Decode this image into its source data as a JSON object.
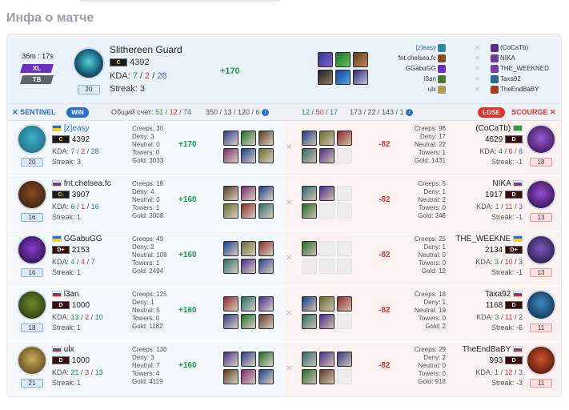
{
  "page_title": "Инфа о матче",
  "summary": {
    "duration": "36m : 17s",
    "badge_size": "XL",
    "badge_mode": "TB",
    "hero": "Slithereen Guard",
    "rank": "C",
    "rating": "4392",
    "kda_label": "KDA:",
    "kills": "7",
    "deaths": "2",
    "assists": "28",
    "streak": "Streak: 3",
    "level": "20",
    "gain": "+170",
    "sentinel_players": [
      "[z]easy",
      "fnt.chelsea.fc",
      "GGabuGG",
      "l3an",
      "ulx"
    ],
    "scourge_players": [
      "(CoCaTb)",
      "NIKA",
      "THE_WEEKNED",
      "Taxa92",
      "TheEndBaBY"
    ]
  },
  "scorebar": {
    "sentinel": "SENTINEL",
    "win": "WIN",
    "total_label": "Общий счет:",
    "s_k": "51",
    "s_d": "12",
    "s_a": "74",
    "s_extra": "350 / 13 / 120 / 6",
    "d_k": "12",
    "d_d": "50",
    "d_a": "17",
    "d_extra": "173 / 22 / 143 / 1",
    "lose": "LOSE",
    "scourge": "SCOURGE"
  },
  "rows": [
    {
      "rad": {
        "name": "[z]easy",
        "rank": "C",
        "rating": "4392",
        "kda_label": "KDA:",
        "k": "7",
        "d": "2",
        "a": "28",
        "streak": "Streak: 3",
        "level": "20",
        "creeps": "Creeps: 30",
        "deny": "Deny: 3",
        "neutral": "Neutral: 0",
        "towers": "Towers: 0",
        "gold": "Gold: 3033",
        "gain": "+170"
      },
      "dire": {
        "name": "(CoCaTb)",
        "rank": "D",
        "rating": "4629",
        "kda_label": "KDA:",
        "k": "4",
        "d": "6",
        "a": "6",
        "streak": "Streak: -1",
        "level": "18",
        "creeps": "Creeps: 96",
        "deny": "Deny: 17",
        "neutral": "Neutral: 22",
        "towers": "Towers: 1",
        "gold": "Gold: 1431",
        "gain": "-82"
      }
    },
    {
      "rad": {
        "name": "fnt.chelsea.fc",
        "rank": "C-",
        "rating": "3907",
        "kda_label": "KDA:",
        "k": "6",
        "d": "1",
        "a": "16",
        "streak": "Streak: 1",
        "level": "16",
        "creeps": "Creeps: 16",
        "deny": "Deny: 4",
        "neutral": "Neutral: 0",
        "towers": "Towers: 1",
        "gold": "Gold: 3008",
        "gain": "+160"
      },
      "dire": {
        "name": "NIKA",
        "rank": "D",
        "rating": "1917",
        "kda_label": "KDA:",
        "k": "1",
        "d": "11",
        "a": "3",
        "streak": "Streak: -1",
        "level": "13",
        "creeps": "Creeps: 5",
        "deny": "Deny: 1",
        "neutral": "Neutral: 2",
        "towers": "Towers: 0",
        "gold": "Gold: 246",
        "gain": "-82"
      }
    },
    {
      "rad": {
        "name": "GGabuGG",
        "rank": "D+",
        "rating": "2153",
        "kda_label": "KDA:",
        "k": "4",
        "d": "4",
        "a": "7",
        "streak": "Streak: 1",
        "level": "16",
        "creeps": "Creeps: 49",
        "deny": "Deny: 2",
        "neutral": "Neutral: 108",
        "towers": "Towers: 1",
        "gold": "Gold: 2494",
        "gain": "+160"
      },
      "dire": {
        "name": "THE_WEEKNE",
        "rank": "D+",
        "rating": "2134",
        "kda_label": "KDA:",
        "k": "3",
        "d": "10",
        "a": "3",
        "streak": "Streak: -1",
        "level": "13",
        "creeps": "Creeps: 25",
        "deny": "Deny: 1",
        "neutral": "Neutral: 0",
        "towers": "Towers: 0",
        "gold": "Gold: 12",
        "gain": "-82"
      }
    },
    {
      "rad": {
        "name": "l3an",
        "rank": "D",
        "rating": "1000",
        "kda_label": "KDA:",
        "k": "13",
        "d": "2",
        "a": "10",
        "streak": "Streak: 1",
        "level": "18",
        "creeps": "Creeps: 125",
        "deny": "Deny: 1",
        "neutral": "Neutral: 5",
        "towers": "Towers: 0",
        "gold": "Gold: 1182",
        "gain": "+160"
      },
      "dire": {
        "name": "Taxa92",
        "rank": "D",
        "rating": "1168",
        "kda_label": "KDA:",
        "k": "3",
        "d": "11",
        "a": "2",
        "streak": "Streak: -6",
        "level": "11",
        "creeps": "Creeps: 18",
        "deny": "Deny: 1",
        "neutral": "Neutral: 19",
        "towers": "Towers: 0",
        "gold": "Gold: 2",
        "gain": "-82"
      }
    },
    {
      "rad": {
        "name": "ulx",
        "rank": "D",
        "rating": "1000",
        "kda_label": "KDA:",
        "k": "21",
        "d": "3",
        "a": "13",
        "streak": "Streak: 1",
        "level": "21",
        "creeps": "Creeps: 130",
        "deny": "Deny: 3",
        "neutral": "Neutral: 7",
        "towers": "Towers: 4",
        "gold": "Gold: 4119",
        "gain": "+160"
      },
      "dire": {
        "name": "TheEndBaBY",
        "rank": "D",
        "rating": "993",
        "kda_label": "KDA:",
        "k": "1",
        "d": "12",
        "a": "3",
        "streak": "Streak: -3",
        "level": "11",
        "creeps": "Creeps: 29",
        "deny": "Deny: 2",
        "neutral": "Neutral: 0",
        "towers": "Towers: 0",
        "gold": "Gold: 918",
        "gain": "-82"
      }
    }
  ],
  "colors": {
    "sentinel": "#2b6fc7",
    "scourge": "#e0332e",
    "win_green": "#1a9c45"
  }
}
